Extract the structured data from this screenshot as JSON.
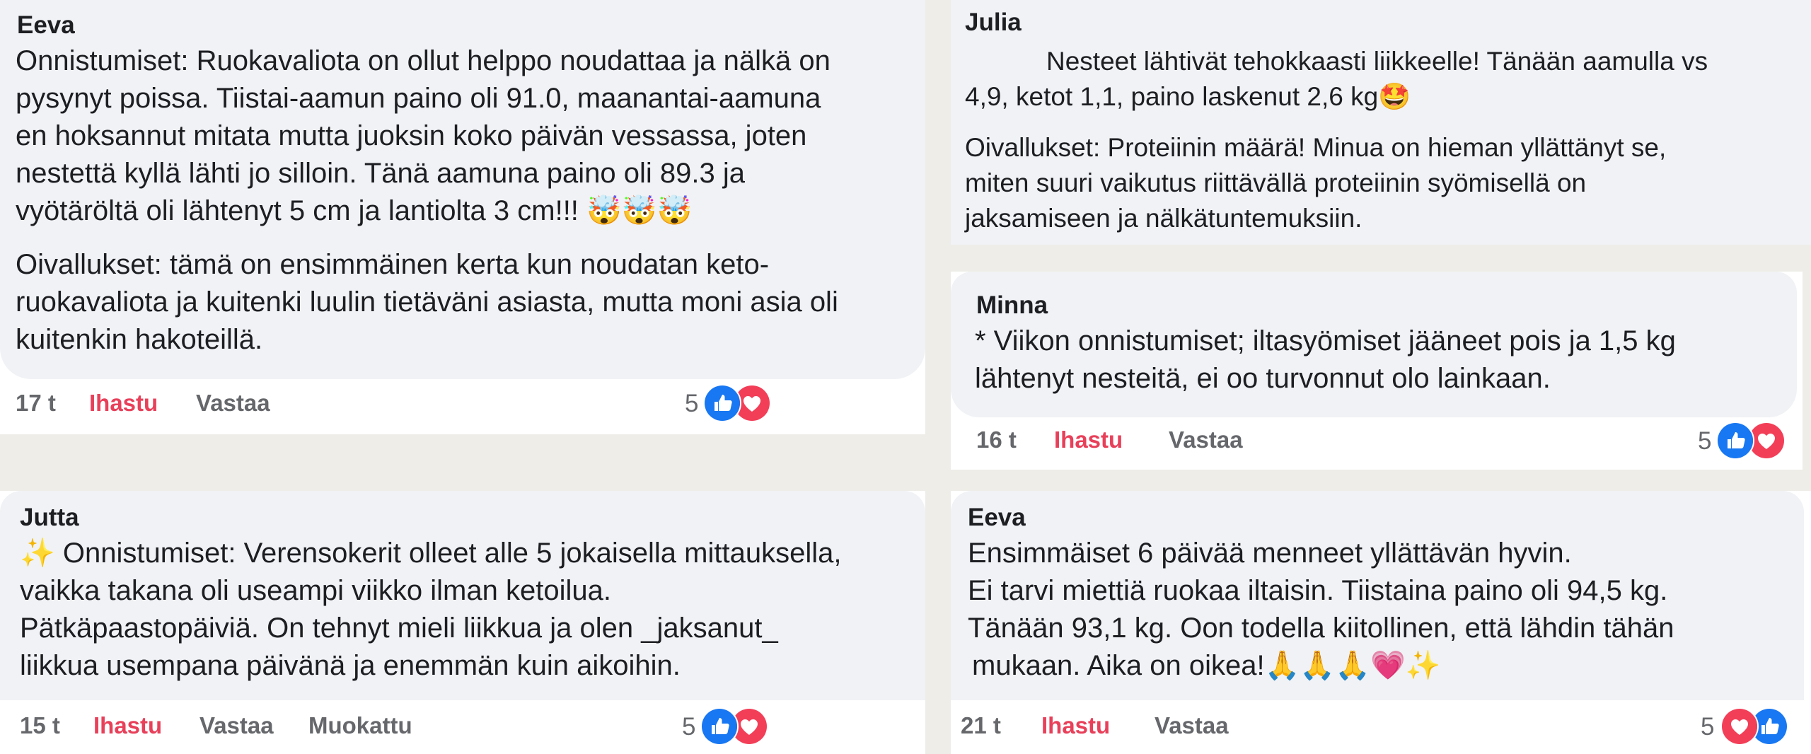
{
  "comments": [
    {
      "author": "Eeva",
      "lines": [
        "Onnistumiset: Ruokavaliota on ollut helppo noudattaa ja nälkä on",
        "pysynyt poissa. Tiistai-aamun paino oli 91.0, maanantai-aamuna",
        "en hoksannut mitata mutta juoksin koko päivän vessassa, joten",
        "nestettä kyllä lähti jo silloin. Tänä aamuna paino oli 89.3 ja",
        "vyötäröltä oli lähtenyt 5 cm ja lantiolta 3 cm!!! 🤯🤯🤯"
      ],
      "lines2": [
        "Oivallukset: tämä on ensimmäinen kerta kun noudatan keto-",
        "ruokavaliota ja kuitenki luulin tietäväni asiasta, mutta moni asia oli",
        "kuitenkin hakoteillä."
      ],
      "time": "17 t",
      "like": "Ihastu",
      "reply": "Vastaa",
      "reaction_count": "5"
    },
    {
      "author": "Julia",
      "lines": [
        "Nesteet lähtivät tehokkaasti liikkeelle! Tänään aamulla vs",
        "4,9, ketot 1,1, paino laskenut 2,6 kg🤩"
      ],
      "lines2": [
        "Oivallukset: Proteiinin määrä! Minua on hieman yllättänyt se,",
        "miten suuri vaikutus riittävällä proteiinin syömisellä on",
        "jaksamiseen ja nälkätuntemuksiin."
      ]
    },
    {
      "author": "Minna",
      "lines": [
        "* Viikon onnistumiset; iltasyömiset jääneet pois ja 1,5 kg",
        "lähtenyt nesteitä, ei oo turvonnut olo lainkaan."
      ],
      "time": "16 t",
      "like": "Ihastu",
      "reply": "Vastaa",
      "reaction_count": "5"
    },
    {
      "author": "Jutta",
      "lines": [
        "✨ Onnistumiset: Verensokerit olleet alle 5 jokaisella mittauksella,",
        "vaikka takana oli useampi viikko ilman ketoilua.",
        "Pätkäpaastopäiviä. On tehnyt mieli liikkua ja olen _jaksanut_",
        "liikkua usempana päivänä ja enemmän kuin aikoihin."
      ],
      "time": "15 t",
      "like": "Ihastu",
      "reply": "Vastaa",
      "edited": "Muokattu",
      "reaction_count": "5"
    },
    {
      "author": "Eeva",
      "lines": [
        "Ensimmäiset 6 päivää menneet yllättävän hyvin.",
        "Ei tarvi miettiä ruokaa iltaisin. Tiistaina paino oli 94,5 kg.",
        "Tänään 93,1 kg. Oon todella kiitollinen, että lähdin tähän",
        "mukaan. Aika on oikea!🙏🙏🙏💗✨"
      ],
      "time": "21 t",
      "like": "Ihastu",
      "reply": "Vastaa",
      "reaction_count": "5"
    }
  ],
  "reaction_icons": [
    "thumbs-up-icon",
    "heart-icon"
  ],
  "colors": {
    "bubble": "#f0f2f5",
    "like_blue": "#1877f2",
    "heart_red": "#f33e58",
    "ihastu": "#e8405a",
    "muted": "#65676b"
  }
}
